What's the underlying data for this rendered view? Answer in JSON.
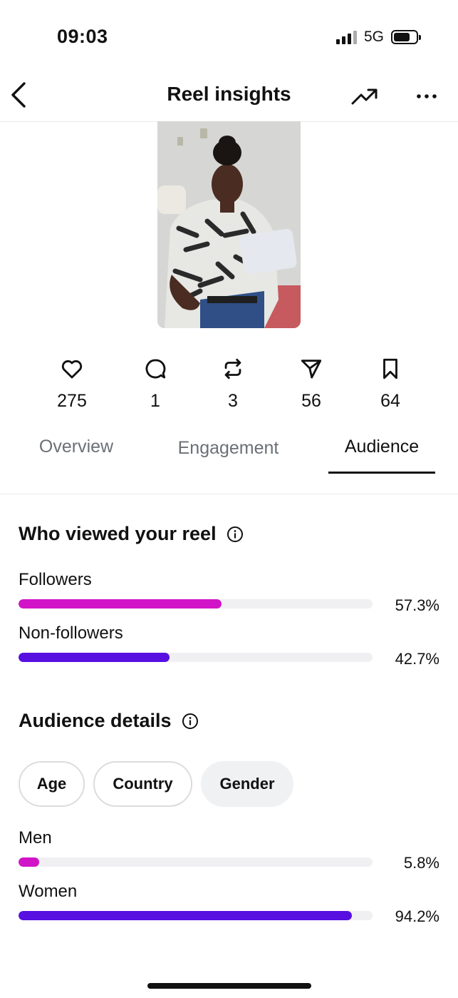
{
  "status": {
    "time": "09:03",
    "network": "5G"
  },
  "header": {
    "title": "Reel insights"
  },
  "icons": {
    "back": "chevron-left-icon",
    "trend": "trending-up-icon",
    "more": "more-horizontal-icon",
    "likes": "heart-icon",
    "comments": "comment-icon",
    "reposts": "repost-icon",
    "shares": "send-icon",
    "saves": "bookmark-icon",
    "info": "info-icon"
  },
  "stats": {
    "likes": "275",
    "comments": "1",
    "reposts": "3",
    "shares": "56",
    "saves": "64"
  },
  "tabs": [
    {
      "label": "Overview",
      "active": false
    },
    {
      "label": "Engagement",
      "active": false
    },
    {
      "label": "Audience",
      "active": true
    }
  ],
  "viewers": {
    "title": "Who viewed your reel",
    "rows": [
      {
        "label": "Followers",
        "value": "57.3%",
        "fraction": 0.573,
        "color": "#d214c8"
      },
      {
        "label": "Non-followers",
        "value": "42.7%",
        "fraction": 0.427,
        "color": "#5710e0"
      }
    ]
  },
  "audience": {
    "title": "Audience details",
    "filters": [
      {
        "label": "Age",
        "selected": false
      },
      {
        "label": "Country",
        "selected": false
      },
      {
        "label": "Gender",
        "selected": true
      }
    ],
    "rows": [
      {
        "label": "Men",
        "value": "5.8%",
        "fraction": 0.058,
        "color": "#d214c8"
      },
      {
        "label": "Women",
        "value": "94.2%",
        "fraction": 0.942,
        "color": "#5710e0"
      }
    ]
  }
}
